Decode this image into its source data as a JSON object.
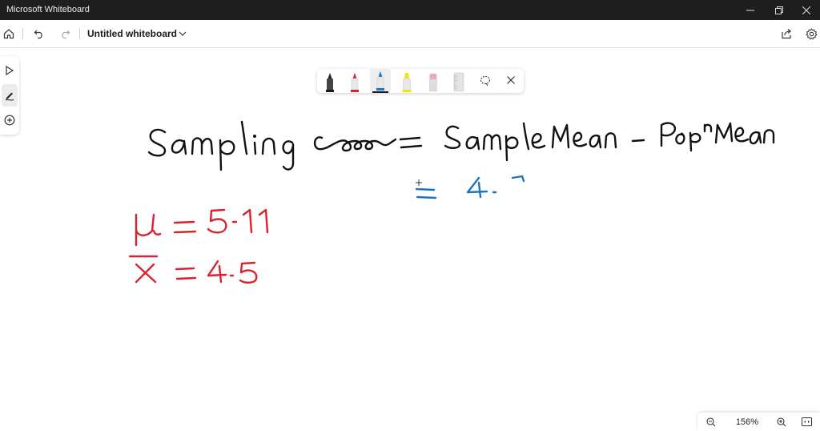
{
  "window": {
    "title": "Microsoft Whiteboard"
  },
  "toolbar": {
    "document_title": "Untitled whiteboard"
  },
  "pens": [
    {
      "name": "black-pen",
      "color": "#1a1a1a"
    },
    {
      "name": "red-pen",
      "color": "#d9232e"
    },
    {
      "name": "blue-pen",
      "color": "#1976c8",
      "selected": true
    },
    {
      "name": "yellow-highlighter",
      "color": "#f2e600"
    },
    {
      "name": "eraser",
      "color": "#f0a8b4"
    },
    {
      "name": "ruler",
      "color": "#dcdcdc"
    }
  ],
  "zoom": {
    "level": "156%"
  },
  "ink_colors": {
    "black": "#111111",
    "red": "#d9232e",
    "blue": "#1c74c2"
  }
}
